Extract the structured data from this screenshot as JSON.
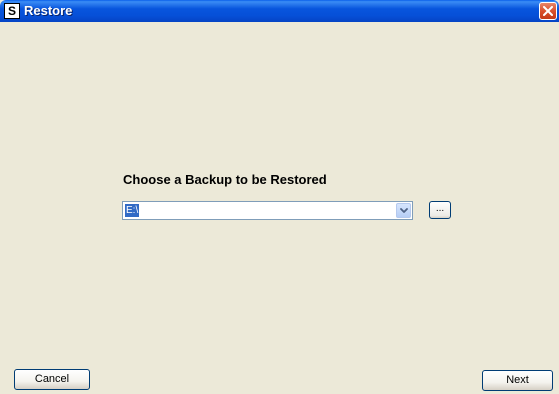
{
  "window": {
    "title": "Restore",
    "app_icon_letter": "S",
    "close_icon": "close-icon"
  },
  "main": {
    "heading": "Choose a Backup to be Restored",
    "backup_select": {
      "value": "E:\\",
      "dropdown_icon": "chevron-down-icon"
    },
    "browse_label": "..."
  },
  "footer": {
    "cancel_label": "Cancel",
    "next_label": "Next"
  },
  "colors": {
    "titlebar": "#0855DD",
    "face": "#ECE9D8",
    "selection": "#316AC5",
    "close": "#D9502C"
  }
}
